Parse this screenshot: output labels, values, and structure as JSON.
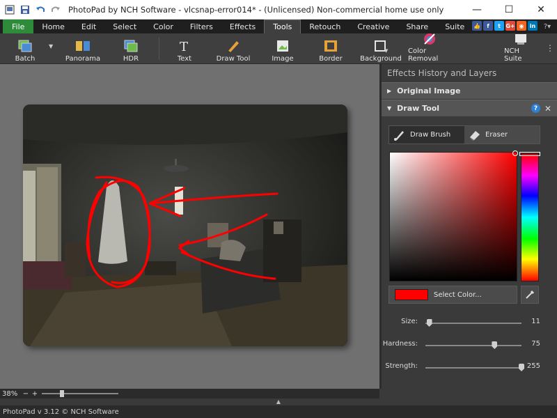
{
  "window": {
    "title": "PhotoPad by NCH Software - vlcsnap-error014* - (Unlicensed) Non-commercial home use only",
    "minimize": "—",
    "maximize": "☐",
    "close": "✕"
  },
  "menu": {
    "tabs": [
      "File",
      "Home",
      "Edit",
      "Select",
      "Color",
      "Filters",
      "Effects",
      "Tools",
      "Retouch",
      "Creative",
      "Share",
      "Suite"
    ],
    "active": "Tools",
    "help": "?▾"
  },
  "social": {
    "icons": [
      "thumbs-up",
      "facebook",
      "twitter",
      "google-plus",
      "rss",
      "linkedin"
    ],
    "glyphs": [
      "👍",
      "f",
      "t",
      "G+",
      "◉",
      "in"
    ]
  },
  "toolbar": {
    "items": [
      {
        "label": "Batch",
        "icon": "batch-icon"
      },
      {
        "label": "Panorama",
        "icon": "panorama-icon"
      },
      {
        "label": "HDR",
        "icon": "hdr-icon"
      },
      {
        "label": "Text",
        "icon": "text-icon"
      },
      {
        "label": "Draw Tool",
        "icon": "pencil-icon"
      },
      {
        "label": "Image",
        "icon": "image-icon"
      },
      {
        "label": "Border",
        "icon": "border-icon"
      },
      {
        "label": "Background",
        "icon": "background-icon"
      },
      {
        "label": "Color Removal",
        "icon": "color-removal-icon"
      },
      {
        "label": "NCH Suite",
        "icon": "nch-suite-icon"
      }
    ],
    "batch_arrow": "▼",
    "overflow": "⋮"
  },
  "panel": {
    "title": "Effects History and Layers",
    "sections": {
      "original": "Original Image",
      "draw_tool": "Draw Tool"
    },
    "brush_tabs": {
      "draw_brush": "Draw Brush",
      "eraser": "Eraser"
    },
    "select_color": "Select Color...",
    "selected_color": "#ff0000",
    "sliders": [
      {
        "label": "Size:",
        "value": "11",
        "fraction": 0.04
      },
      {
        "label": "Hardness:",
        "value": "75",
        "fraction": 0.72
      },
      {
        "label": "Strength:",
        "value": "255",
        "fraction": 1.0
      }
    ]
  },
  "zoom": {
    "value": "38%",
    "minus": "−",
    "plus": "+",
    "fraction": 0.25
  },
  "status": {
    "text": "PhotoPad v 3.12 © NCH Software"
  },
  "colors": {
    "accent_green": "#2e8b3a",
    "annotation_red": "#ff0000"
  }
}
